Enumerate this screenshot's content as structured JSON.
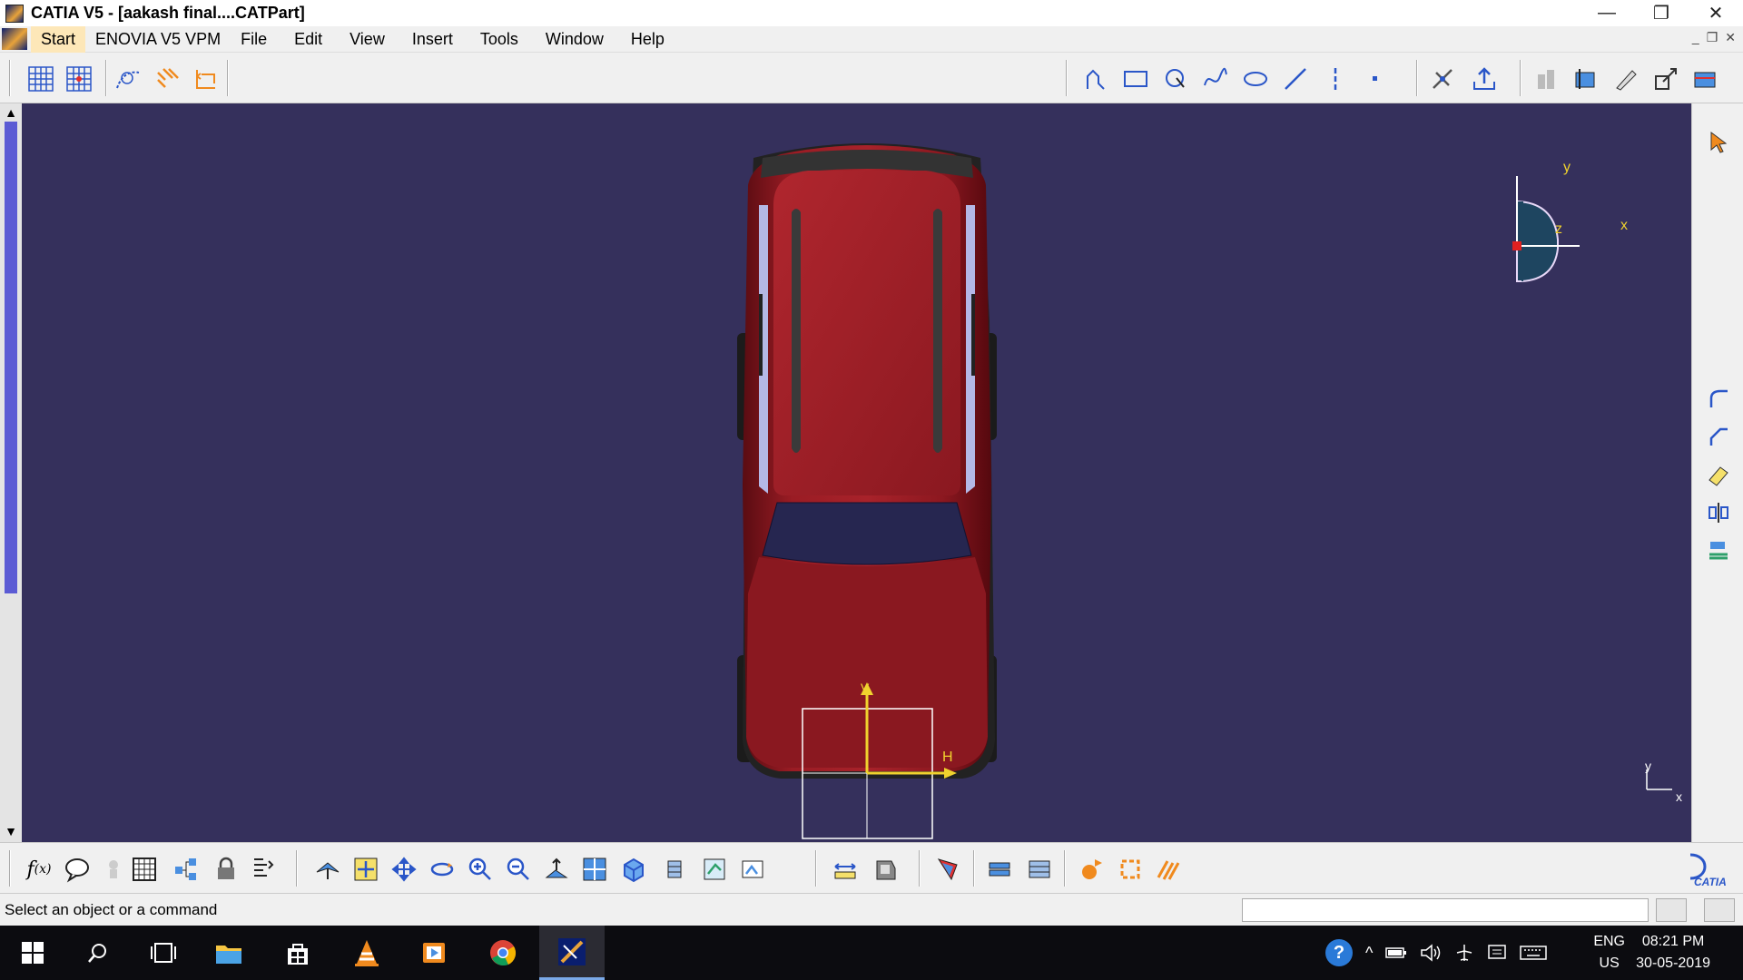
{
  "window": {
    "title": "CATIA V5 - [aakash final....CATPart]",
    "minimize": "—",
    "restore": "❐",
    "close": "✕"
  },
  "menubar": {
    "items": [
      "Start",
      "ENOVIA V5 VPM",
      "File",
      "Edit",
      "View",
      "Insert",
      "Tools",
      "Window",
      "Help"
    ]
  },
  "mdi": {
    "minimize": "_",
    "restore": "❐",
    "close": "✕"
  },
  "viewport": {
    "background": "#35305c",
    "compass": {
      "x_label": "x",
      "y_label": "y",
      "z_label": "z"
    },
    "sketch_axes": {
      "v_label": "V",
      "h_label": "H"
    },
    "corner_axes": {
      "x_label": "x",
      "y_label": "y"
    }
  },
  "status": {
    "message": "Select an object or a command"
  },
  "taskbar": {
    "lang_top": "ENG",
    "lang_bottom": "US",
    "time": "08:21 PM",
    "date": "30-05-2019"
  },
  "colors": {
    "car_body": "#8a1820",
    "accent_orange": "#f08a1e",
    "axis_yellow": "#f0d22e",
    "toolbar_bg": "#f0f0f0"
  }
}
